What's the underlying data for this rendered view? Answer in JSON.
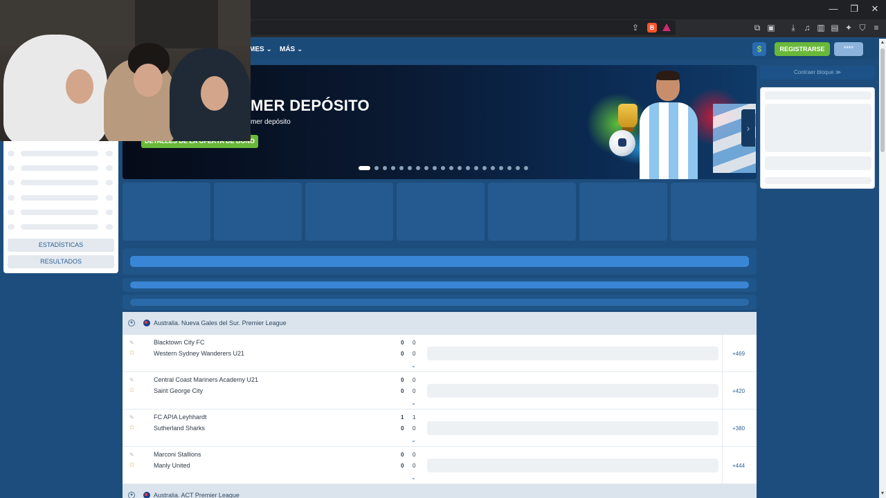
{
  "nav": {
    "games_partial": "MES",
    "more": "MÁS"
  },
  "header": {
    "dollar": "$",
    "register": "REGISTRARSE",
    "login": "****"
  },
  "banner": {
    "title": "MER DEPÓSITO",
    "subtitle": "mer depósito",
    "button": "DETALLES DE LA OFERTA DE BONO",
    "slide_count": 20,
    "active_slide": 0
  },
  "sidebar": {
    "statistics": "ESTADÍSTICAS",
    "results": "RESULTADOS"
  },
  "right_widget": {
    "collapse_label": "Contraer bloque ≫"
  },
  "leagues": [
    {
      "name": "Australia. Nueva Gales del Sur. Premier League",
      "matches": [
        {
          "home": "Blacktown City FC",
          "away": "Western Sydney Wanderers U21",
          "home_score": "0",
          "away_score": "0",
          "home_half": "0",
          "away_half": "0",
          "more": "+469"
        },
        {
          "home": "Central Coast Mariners Academy U21",
          "away": "Saint George City",
          "home_score": "0",
          "away_score": "0",
          "home_half": "0",
          "away_half": "0",
          "more": "+420"
        },
        {
          "home": "FC APIA Leyhhardt",
          "away": "Sutherland Sharks",
          "home_score": "1",
          "away_score": "0",
          "home_half": "1",
          "away_half": "0",
          "more": "+380"
        },
        {
          "home": "Marconi Stallions",
          "away": "Manly United",
          "home_score": "0",
          "away_score": "0",
          "home_half": "0",
          "away_half": "0",
          "more": "+444"
        }
      ]
    },
    {
      "name": "Australia. ACT Premier League",
      "matches": []
    }
  ],
  "colors": {
    "page_bg": "#1d4d7c",
    "accent_green": "#6ab83a",
    "header_blue": "#1a4a78",
    "skeleton_blue": "#3a86d6"
  },
  "icons": {
    "close": "✕",
    "maximize": "❐",
    "minimize": "—",
    "chevron_down": "⌄",
    "chevron_right": "›",
    "pin": "✎",
    "star": "☆"
  }
}
